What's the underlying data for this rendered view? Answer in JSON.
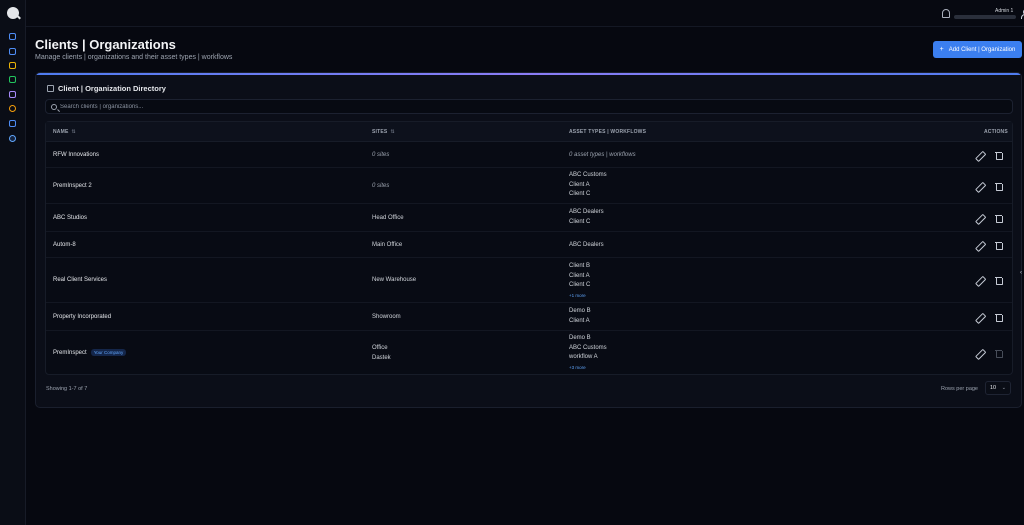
{
  "app": {
    "nav_icons": [
      "search-logo",
      "calendar-icon",
      "grid-icon",
      "bell-icon",
      "clipboard-icon",
      "calendar-icon",
      "clock-icon",
      "chart-icon",
      "settings-icon"
    ]
  },
  "topbar": {
    "user_name": "Admin 1",
    "theme_toggle": "☾"
  },
  "page": {
    "title": "Clients | Organizations",
    "subtitle": "Manage clients | organizations and their asset types | workflows",
    "add_button": "Add Client | Organization",
    "add_icon": "+"
  },
  "directory": {
    "title": "Client | Organization Directory",
    "search_placeholder": "Search clients | organizations...",
    "columns": {
      "name": "NAME",
      "sites": "SITES",
      "asset_types": "ASSET TYPES | WORKFLOWS",
      "actions": "ACTIONS"
    },
    "rows": [
      {
        "name": "RFW Innovations",
        "sites": "0 sites",
        "assets": "0 asset types | workflows"
      },
      {
        "name": "PremInspect 2",
        "sites": "0 sites",
        "assets": [
          "ABC Customs",
          "Client A",
          "Client C"
        ]
      },
      {
        "name": "ABC Studios",
        "sites": "Head Office",
        "assets": [
          "ABC Dealers",
          "Client C"
        ]
      },
      {
        "name": "Autom-8",
        "sites": "Main Office",
        "assets": [
          "ABC Dealers"
        ]
      },
      {
        "name": "Real Client Services",
        "sites": "New Warehouse",
        "assets": [
          "Client B",
          "Client A",
          "Client C"
        ],
        "more": "+1 more"
      },
      {
        "name": "Property Incorporated",
        "sites": "Showroom",
        "assets": [
          "Demo B",
          "Client A"
        ]
      },
      {
        "name": "PremInspect",
        "badge": "Your Company",
        "sites": [
          "Office",
          "Dastek"
        ],
        "assets": [
          "Demo B",
          "ABC Customs",
          "workflow A"
        ],
        "more": "+3 more"
      }
    ],
    "footer": {
      "showing": "Showing 1-7 of 7",
      "rows_label": "Rows per page",
      "rows_value": "10"
    }
  },
  "colors": {
    "accent": "#3b7ff0",
    "background": "#060810",
    "card": "#0b0e18",
    "link": "#60a5fa"
  }
}
